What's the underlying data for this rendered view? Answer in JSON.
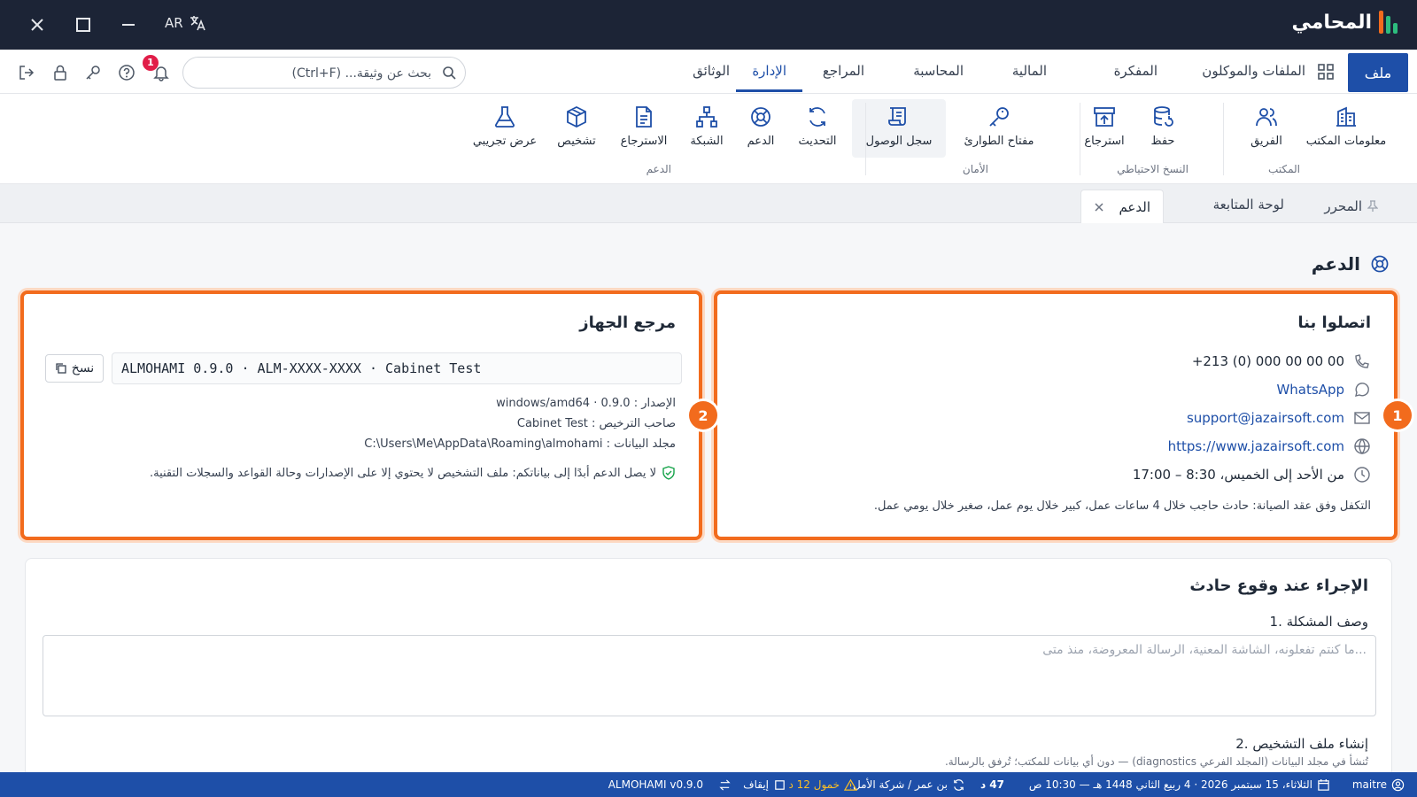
{
  "app": {
    "name": "المحامي",
    "lang": "AR"
  },
  "menu": {
    "file": "ملف",
    "tabs": [
      "الملفات والموكلون",
      "المفكرة",
      "المالية",
      "المحاسبة",
      "المراجع",
      "الإدارة",
      "الوثائق"
    ],
    "active_tab": "الإدارة"
  },
  "search": {
    "placeholder": "بحث عن وثيقة... (Ctrl+F)"
  },
  "notifications": {
    "count": "1"
  },
  "ribbon": {
    "groups": [
      {
        "name": "المكتب",
        "buttons": [
          "معلومات المكتب",
          "الفريق"
        ]
      },
      {
        "name": "النسخ الاحتياطي",
        "buttons": [
          "حفظ",
          "استرجاع"
        ]
      },
      {
        "name": "الأمان",
        "buttons": [
          "مفتاح الطوارئ",
          "سجل الوصول"
        ]
      },
      {
        "name": "الدعم",
        "buttons": [
          "التحديث",
          "الدعم",
          "الشبكة",
          "الاسترجاع",
          "تشخيص",
          "عرض تجريبي"
        ]
      }
    ]
  },
  "doc_tabs": {
    "editor": "المحرر",
    "dashboard": "لوحة المتابعة",
    "support": "الدعم"
  },
  "page": {
    "title": "الدعم"
  },
  "contact": {
    "title": "اتصلوا بنا",
    "phone": "+213 (0) 000 00 00 00",
    "whatsapp": "WhatsApp",
    "email": "support@jazairsoft.com",
    "website": "https://www.jazairsoft.com",
    "hours": "من الأحد إلى الخميس، 8:30 – 17:00",
    "sla": "التكفل وفق عقد الصيانة: حادث حاجب خلال 4 ساعات عمل، كبير خلال يوم عمل، صغير خلال يومي عمل.",
    "callout": "1"
  },
  "device": {
    "title": "مرجع الجهاز",
    "reference": "ALMOHAMI 0.9.0 · ALM-XXXX-XXXX · Cabinet Test",
    "copy": "نسخ",
    "version_label": "الإصدار :",
    "version": "0.9.0 · windows/amd64",
    "licensee_label": "صاحب الترخيص :",
    "licensee": "Cabinet Test",
    "datadir_label": "مجلد البيانات :",
    "datadir": "C:\\Users\\Me\\AppData\\Roaming\\almohami",
    "privacy": "لا يصل الدعم أبدًا إلى بياناتكم: ملف التشخيص لا يحتوي إلا على الإصدارات وحالة القواعد والسجلات التقنية.",
    "callout": "2"
  },
  "incident": {
    "title": "الإجراء عند وقوع حادث",
    "step1": "1. وصف المشكلة",
    "placeholder": "...ما كنتم تفعلونه، الشاشة المعنية، الرسالة المعروضة، منذ متى",
    "step2": "2. إنشاء ملف التشخيص",
    "step2_note": "تُنشأ في مجلد البيانات (المجلد الفرعي diagnostics) — دون أي بيانات للمكتب؛ تُرفق بالرسالة."
  },
  "status": {
    "user": "maitre",
    "date": "الثلاثاء، 15 سبتمبر 2026 · 4 ربيع الثاني 1448 هـ — 10:30 ص",
    "timer": "47 د",
    "client": "بن عمر / شركة الأمل",
    "idle": "خمول 12 د",
    "stop": "إيقاف",
    "version": "ALMOHAMI v0.9.0"
  },
  "colors": {
    "brand": "#1e4fa8",
    "titlebar": "#1c2436",
    "callout": "#f26b1d",
    "logo": "#2dbd7e"
  }
}
